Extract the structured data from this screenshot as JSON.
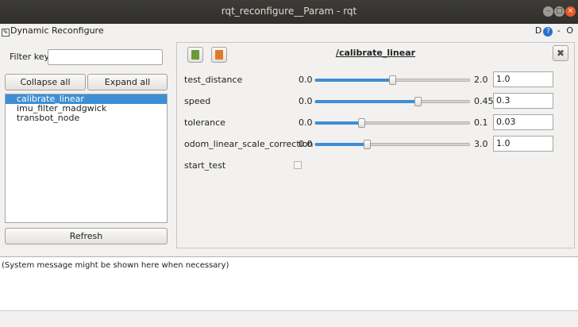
{
  "window": {
    "title": "rqt_reconfigure__Param - rqt",
    "controls": [
      "minimize-icon",
      "maximize-icon",
      "close-icon"
    ]
  },
  "plugin": {
    "title": "Dynamic Reconfigure",
    "right_d": "D",
    "right_help": "?",
    "right_dash": "-",
    "right_o": "O"
  },
  "filter": {
    "label": "Filter key:",
    "value": "",
    "placeholder": ""
  },
  "buttons": {
    "collapse": "Collapse all",
    "expand": "Expand all",
    "refresh": "Refresh"
  },
  "tree": {
    "nodes": [
      {
        "label": "calibrate_linear",
        "selected": true
      },
      {
        "label": "imu_filter_madgwick",
        "selected": false
      },
      {
        "label": "transbot_node",
        "selected": false
      }
    ]
  },
  "node_panel": {
    "title": "/calibrate_linear",
    "load_icon": "load-icon",
    "save_icon": "save-icon",
    "close_glyph": "✖"
  },
  "params": [
    {
      "name": "test_distance",
      "min": "0.0",
      "max": "2.0",
      "value": "1.0",
      "fraction": 0.5
    },
    {
      "name": "speed",
      "min": "0.0",
      "max": "0.45",
      "value": "0.3",
      "fraction": 0.6667
    },
    {
      "name": "tolerance",
      "min": "0.0",
      "max": "0.1",
      "value": "0.03",
      "fraction": 0.3
    },
    {
      "name": "odom_linear_scale_correction",
      "min": "0.0",
      "max": "3.0",
      "value": "1.0",
      "fraction": 0.3333
    }
  ],
  "bool_param": {
    "name": "start_test",
    "checked": false
  },
  "status": {
    "message": "(System message might be shown here when necessary)"
  },
  "colors": {
    "accent": "#3d8ed4",
    "titlebar": "#3d3c38",
    "close": "#e9592a"
  }
}
